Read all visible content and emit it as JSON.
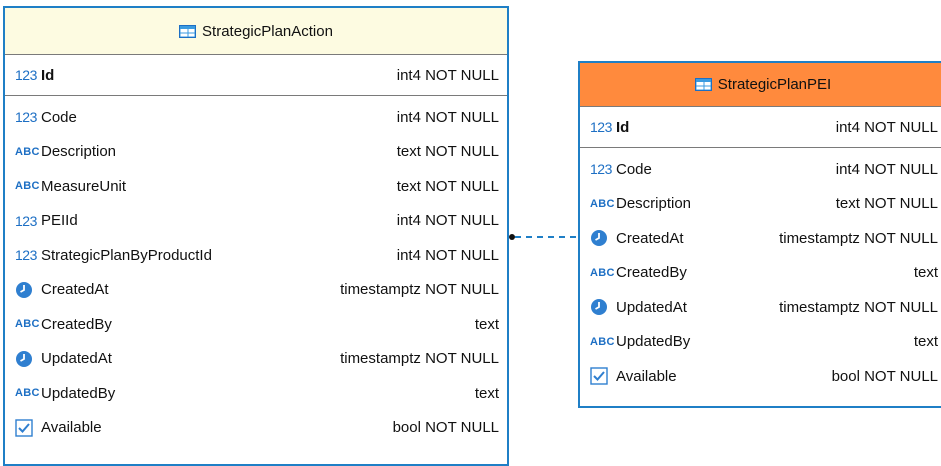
{
  "tables": [
    {
      "name": "StrategicPlanAction",
      "header_color": "#fdfbe1",
      "pk": {
        "name": "Id",
        "type": "int4 NOT NULL",
        "icon": "123-pk-icon",
        "icon_text": "123"
      },
      "columns": [
        {
          "name": "Code",
          "type": "int4 NOT NULL",
          "icon": "123-icon",
          "icon_text": "123"
        },
        {
          "name": "Description",
          "type": "text NOT NULL",
          "icon": "abc-icon",
          "icon_text": "ABC"
        },
        {
          "name": "MeasureUnit",
          "type": "text NOT NULL",
          "icon": "abc-icon",
          "icon_text": "ABC"
        },
        {
          "name": "PEIId",
          "type": "int4 NOT NULL",
          "icon": "123-icon",
          "icon_text": "123"
        },
        {
          "name": "StrategicPlanByProductId",
          "type": "int4 NOT NULL",
          "icon": "123-icon",
          "icon_text": "123"
        },
        {
          "name": "CreatedAt",
          "type": "timestamptz NOT NULL",
          "icon": "clock-icon"
        },
        {
          "name": "CreatedBy",
          "type": "text",
          "icon": "abc-icon",
          "icon_text": "ABC"
        },
        {
          "name": "UpdatedAt",
          "type": "timestamptz NOT NULL",
          "icon": "clock-icon"
        },
        {
          "name": "UpdatedBy",
          "type": "text",
          "icon": "abc-icon",
          "icon_text": "ABC"
        },
        {
          "name": "Available",
          "type": "bool NOT NULL",
          "icon": "checkbox-icon"
        }
      ]
    },
    {
      "name": "StrategicPlanPEI",
      "header_color": "#ff8a3d",
      "pk": {
        "name": "Id",
        "type": "int4 NOT NULL",
        "icon": "123-pk-icon",
        "icon_text": "123"
      },
      "columns": [
        {
          "name": "Code",
          "type": "int4 NOT NULL",
          "icon": "123-icon",
          "icon_text": "123"
        },
        {
          "name": "Description",
          "type": "text NOT NULL",
          "icon": "abc-icon",
          "icon_text": "ABC"
        },
        {
          "name": "CreatedAt",
          "type": "timestamptz NOT NULL",
          "icon": "clock-icon"
        },
        {
          "name": "CreatedBy",
          "type": "text",
          "icon": "abc-icon",
          "icon_text": "ABC"
        },
        {
          "name": "UpdatedAt",
          "type": "timestamptz NOT NULL",
          "icon": "clock-icon"
        },
        {
          "name": "UpdatedBy",
          "type": "text",
          "icon": "abc-icon",
          "icon_text": "ABC"
        },
        {
          "name": "Available",
          "type": "bool NOT NULL",
          "icon": "checkbox-icon"
        }
      ]
    }
  ],
  "colors": {
    "border": "#1f7fc6",
    "icon": "#1d6fc4",
    "connector": "#1f7fc6"
  }
}
